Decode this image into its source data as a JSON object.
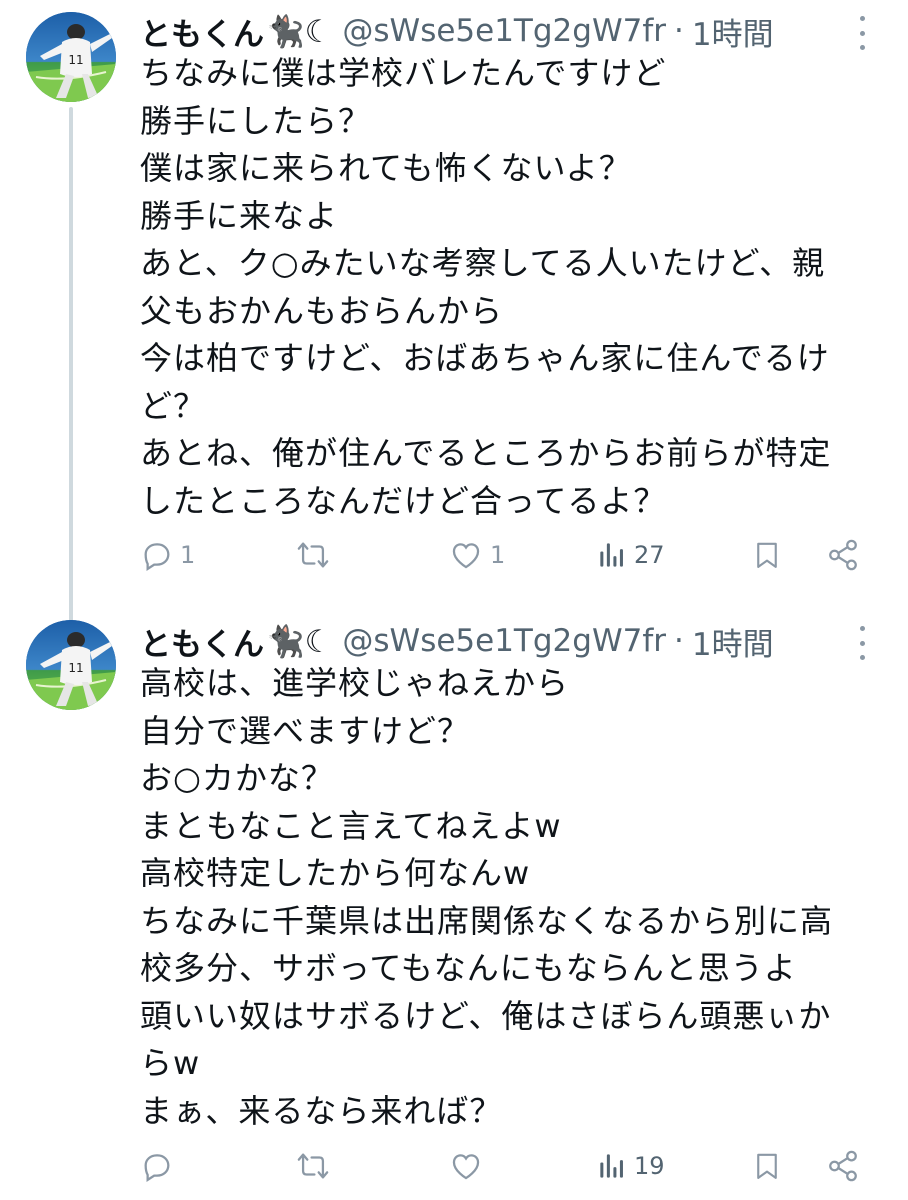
{
  "tweets": [
    {
      "display_name": "ともくん",
      "name_emoji": "🐈‍⬛☾",
      "handle": "@sWse5e1Tg2gW7fr",
      "separator": "·",
      "time": "1時間",
      "lines": [
        "ちなみに僕は学校バレたんですけど",
        "勝手にしたら？",
        "僕は家に来られても怖くないよ？",
        "勝手に来なよ",
        "あと、ク○みたいな考察してる人いたけど、親",
        "父もおかんもおらんから",
        "今は柏ですけど、おばあちゃん家に住んでるけ",
        "ど？",
        "あとね、俺が住んでるところからお前らが特定",
        "したところなんだけど合ってるよ？"
      ],
      "actions": {
        "reply_count": "1",
        "retweet_count": "",
        "like_count": "1",
        "views_count": "27"
      }
    },
    {
      "display_name": "ともくん",
      "name_emoji": "🐈‍⬛☾",
      "handle": "@sWse5e1Tg2gW7fr",
      "separator": "·",
      "time": "1時間",
      "lines": [
        "高校は、進学校じゃねえから",
        "自分で選べますけど？",
        "お○カかな？",
        "まともなこと言えてねえよw",
        "高校特定したから何なんw",
        "ちなみに千葉県は出席関係なくなるから別に高",
        "校多分、サボってもなんにもならんと思うよ",
        "頭いい奴はサボるけど、俺はさぼらん頭悪ぃか",
        "らw",
        "まぁ、来るなら来れば？"
      ],
      "actions": {
        "reply_count": "",
        "retweet_count": "",
        "like_count": "",
        "views_count": "19"
      }
    }
  ],
  "colors": {
    "text_primary": "#0f1419",
    "text_secondary": "#536471",
    "icon_gray": "#8b98a5",
    "thread_line": "#cfd9de"
  },
  "icons": {
    "reply": "reply-icon",
    "retweet": "retweet-icon",
    "like": "heart-icon",
    "views": "views-chart-icon",
    "bookmark": "bookmark-icon",
    "share": "share-icon",
    "more": "more-dots-icon"
  }
}
